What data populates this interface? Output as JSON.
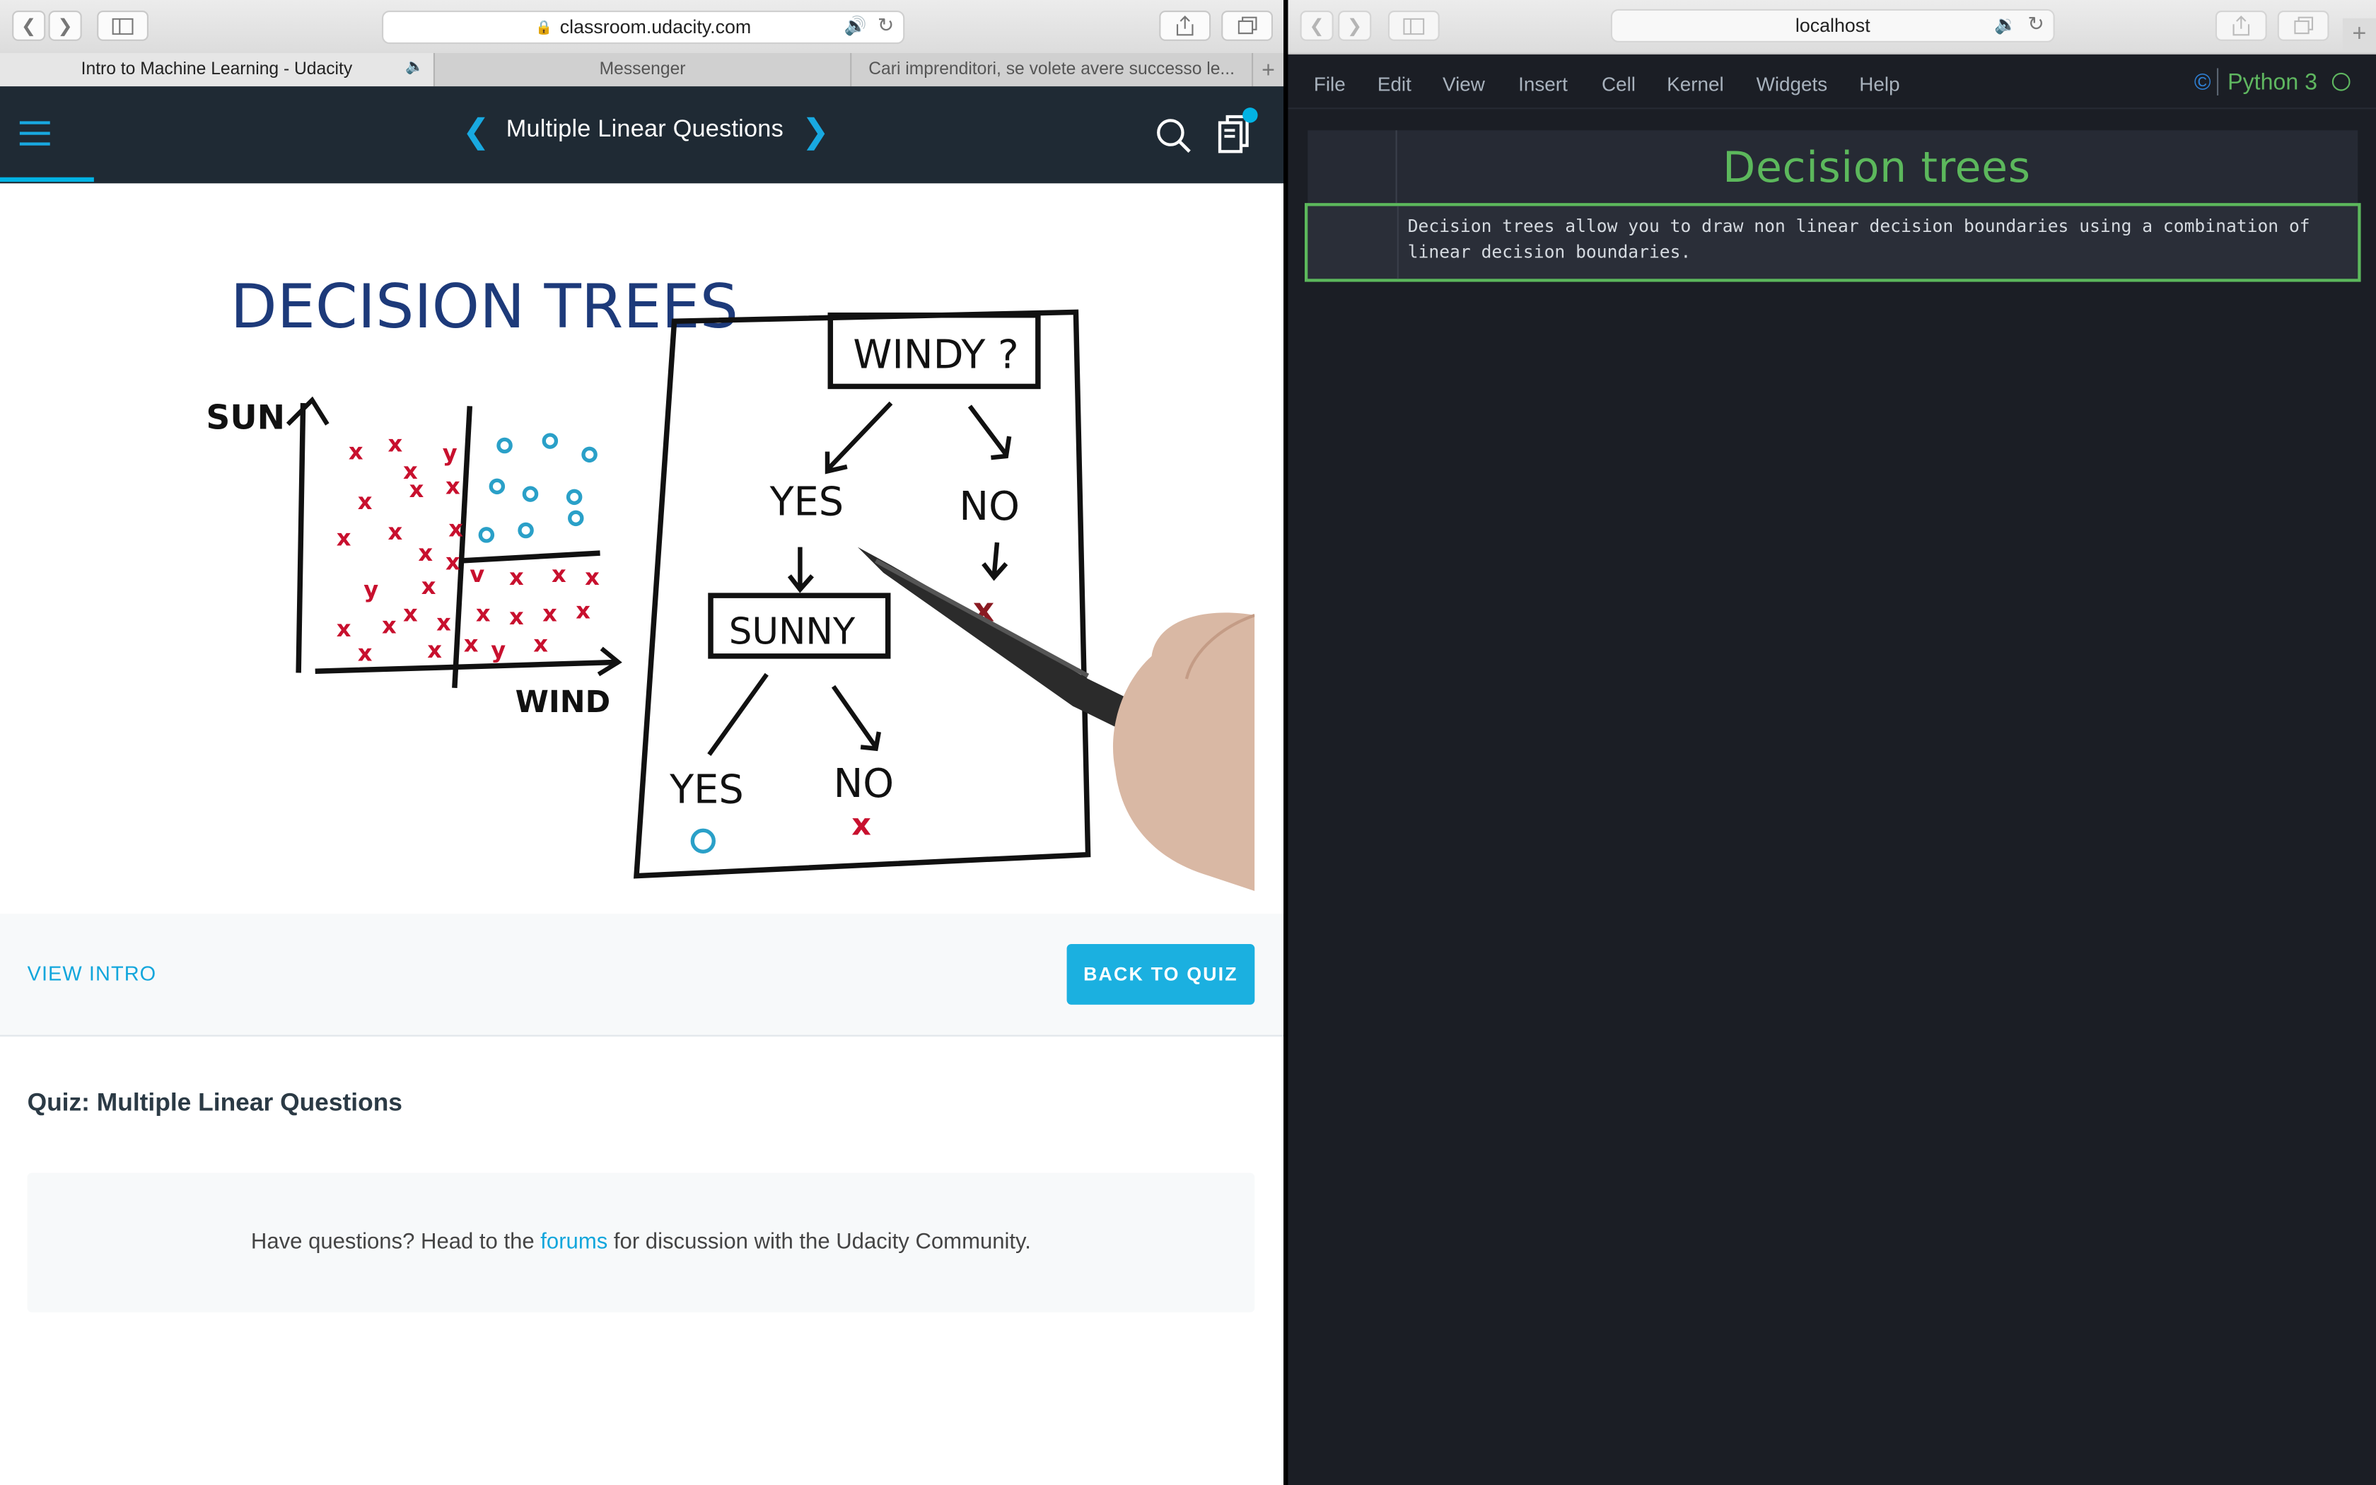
{
  "left_browser": {
    "address": "classroom.udacity.com",
    "tabs": [
      {
        "label": "Intro to Machine Learning - Udacity",
        "active": true,
        "audio": true
      },
      {
        "label": "Messenger",
        "active": false
      },
      {
        "label": "Cari imprenditori, se volete avere successo le...",
        "active": false
      }
    ]
  },
  "udacity": {
    "nav_title": "Multiple Linear Questions",
    "video_title": "DECISION TREES",
    "view_intro": "VIEW INTRO",
    "back_to_quiz": "BACK TO QUIZ",
    "quiz_heading": "Quiz: Multiple Linear Questions",
    "forum_prefix": "Have questions? Head to the ",
    "forum_link": "forums",
    "forum_suffix": " for discussion with the Udacity Community.",
    "accent_color": "#02b3e4"
  },
  "drawing": {
    "axis_y": "SUN",
    "axis_x": "WIND",
    "root_question": "WINDY ?",
    "branch_yes": "YES",
    "branch_no": "NO",
    "sub_question": "SUNNY",
    "leaf_yes": "YES",
    "leaf_no": "NO"
  },
  "right_browser": {
    "address": "localhost"
  },
  "jupyter": {
    "menu": [
      "File",
      "Edit",
      "View",
      "Insert",
      "Cell",
      "Kernel",
      "Widgets",
      "Help"
    ],
    "kernel_name": "Python 3",
    "header_cell": "Decision trees",
    "markdown_cell": "Decision trees allow you to draw non linear decision boundaries using a combination of linear decision boundaries.",
    "accent_color": "#5cb85c"
  }
}
